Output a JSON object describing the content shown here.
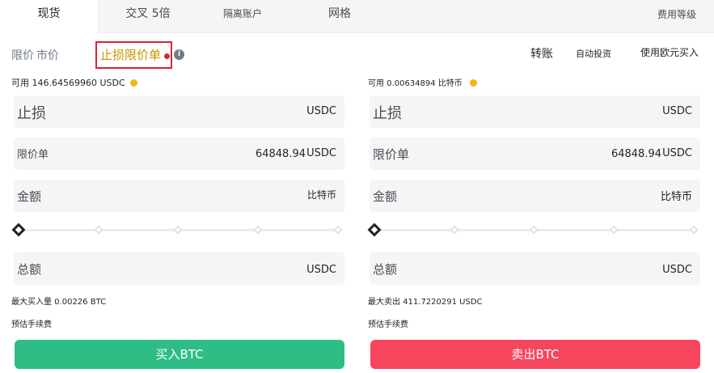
{
  "tabs": {
    "spot": "现货",
    "cross": "交叉 5倍",
    "isolated": "隔离账户",
    "grid": "网格",
    "fee_level": "费用等级"
  },
  "order_types": {
    "limit": "限价",
    "market": "市价",
    "stop_limit": "止损限价单"
  },
  "actions": {
    "transfer": "转账",
    "auto_invest": "自动投资",
    "buy_with_eur": "使用欧元买入"
  },
  "buy": {
    "available": "可用 146.64569960 USDC",
    "stop_label": "止损",
    "stop_unit": "USDC",
    "limit_label": "限价单",
    "limit_value": "64848.94",
    "limit_unit": "USDC",
    "amount_label": "金额",
    "amount_unit": "比特币",
    "total_label": "总额",
    "total_unit": "USDC",
    "max_text": "最大买入量 0.00226 BTC",
    "fee_text": "预估手续费",
    "button": "买入BTC",
    "slider_percent": 0
  },
  "sell": {
    "available": "可用 0.00634894 比特币",
    "stop_label": "止损",
    "stop_unit": "USDC",
    "limit_label": "限价单",
    "limit_value": "64848.94",
    "limit_unit": "USDC",
    "amount_label": "金额",
    "amount_unit": "比特币",
    "total_label": "总额",
    "total_unit": "USDC",
    "max_text": "最大卖出 411.7220291 USDC",
    "fee_text": "预估手续费",
    "button": "卖出BTC",
    "slider_percent": 0
  },
  "colors": {
    "buy": "#2ebd85",
    "sell": "#f6465d",
    "accent": "#c99400",
    "highlight_box": "#d9272e"
  },
  "icons": {
    "info": "info-icon",
    "coin": "coin-icon"
  }
}
